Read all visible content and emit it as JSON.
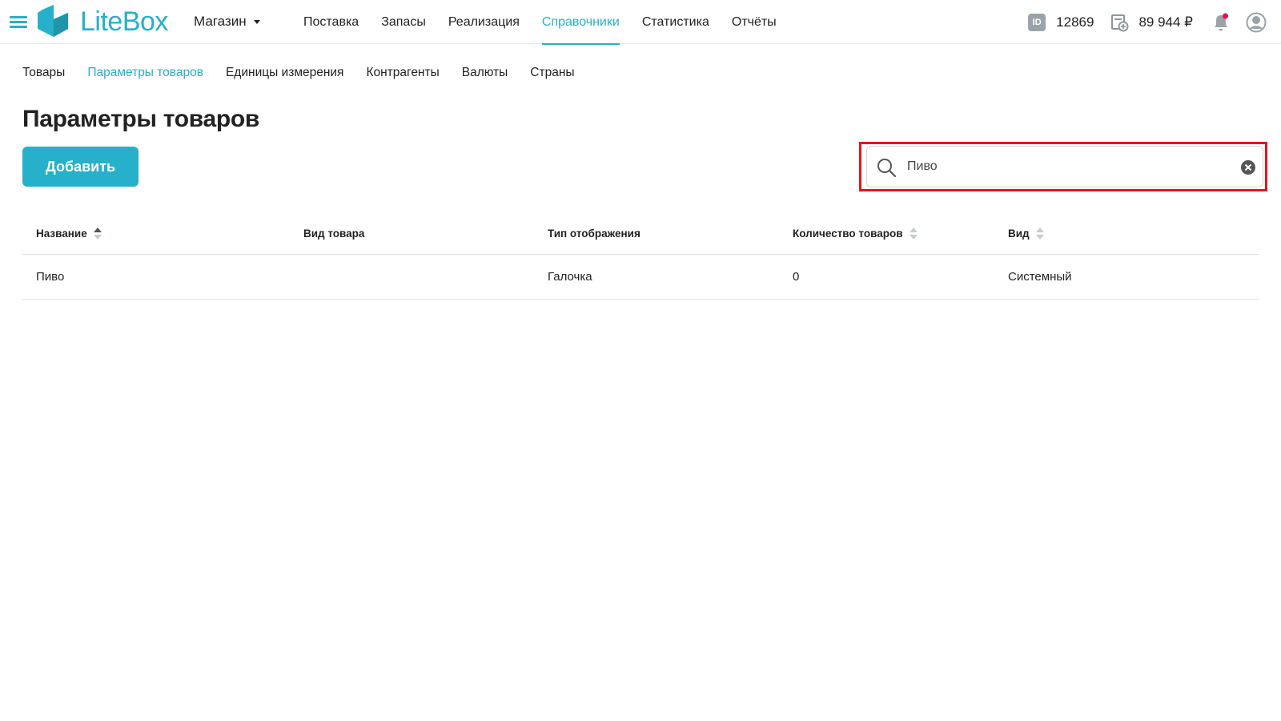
{
  "app": {
    "logo_text": "LiteBox",
    "store_selector": "Магазин"
  },
  "top_nav": [
    {
      "label": "Поставка",
      "active": false
    },
    {
      "label": "Запасы",
      "active": false
    },
    {
      "label": "Реализация",
      "active": false
    },
    {
      "label": "Справочники",
      "active": true
    },
    {
      "label": "Статистика",
      "active": false
    },
    {
      "label": "Отчёты",
      "active": false
    }
  ],
  "header_right": {
    "id_icon_text": "ID",
    "account_id": "12869",
    "balance": "89 944 ₽",
    "has_notification": true
  },
  "sub_nav": [
    {
      "label": "Товары",
      "active": false
    },
    {
      "label": "Параметры товаров",
      "active": true
    },
    {
      "label": "Единицы измерения",
      "active": false
    },
    {
      "label": "Контрагенты",
      "active": false
    },
    {
      "label": "Валюты",
      "active": false
    },
    {
      "label": "Страны",
      "active": false
    }
  ],
  "page": {
    "title": "Параметры товаров",
    "add_button": "Добавить"
  },
  "search": {
    "value": "Пиво",
    "highlighted": true
  },
  "table": {
    "columns": [
      {
        "label": "Название",
        "sortable": true,
        "sort": "asc"
      },
      {
        "label": "Вид товара",
        "sortable": false
      },
      {
        "label": "Тип отображения",
        "sortable": false
      },
      {
        "label": "Количество товаров",
        "sortable": true,
        "sort": "none"
      },
      {
        "label": "Вид",
        "sortable": true,
        "sort": "none"
      }
    ],
    "rows": [
      [
        "Пиво",
        "",
        "Галочка",
        "0",
        "Системный"
      ]
    ]
  },
  "colors": {
    "accent": "#26b0c9",
    "highlight_border": "#e3141c",
    "notification_dot": "#e0134b"
  },
  "icons": [
    "menu-icon",
    "logo-icon",
    "id-icon",
    "wallet-icon",
    "bell-icon",
    "user-avatar-icon",
    "search-icon",
    "clear-icon",
    "sort-icon"
  ]
}
